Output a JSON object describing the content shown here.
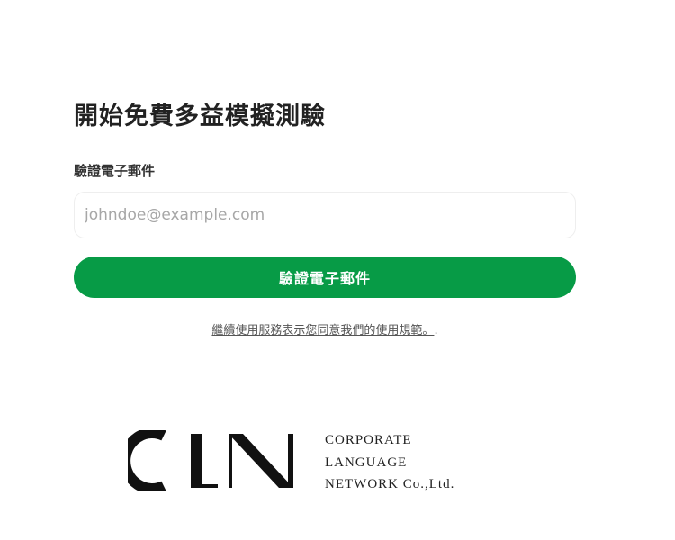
{
  "form": {
    "title": "開始免費多益模擬測驗",
    "email_label": "驗證電子郵件",
    "email_placeholder": "johndoe@example.com",
    "email_value": "",
    "submit_label": "驗證電子郵件",
    "terms_link_text": "繼續使用服務表示您同意我們的使用規範。",
    "terms_suffix": "."
  },
  "logo": {
    "mark_text": "CLN",
    "line1": "CORPORATE",
    "line2": "LANGUAGE",
    "line3": "NETWORK Co.,Ltd."
  },
  "colors": {
    "accent": "#079b46",
    "title": "#222222",
    "placeholder": "#a7a7a7"
  }
}
